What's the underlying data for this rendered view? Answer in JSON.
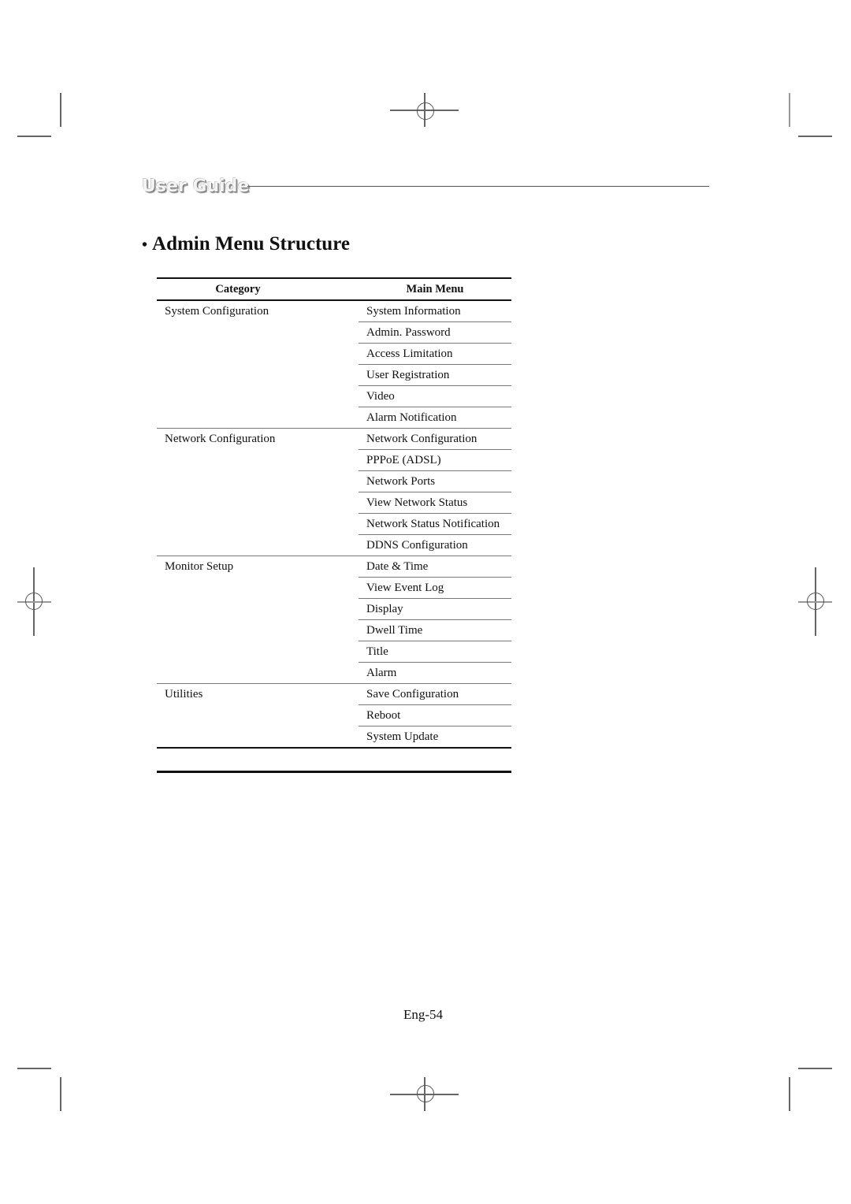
{
  "header": {
    "logo_text": "User Guide"
  },
  "section": {
    "bullet": "•",
    "title": "Admin Menu Structure"
  },
  "table": {
    "headers": {
      "category": "Category",
      "main_menu": "Main Menu"
    },
    "groups": [
      {
        "category": "System Configuration",
        "items": [
          "System Information",
          "Admin. Password",
          "Access Limitation",
          "User Registration",
          "Video",
          "Alarm Notification"
        ]
      },
      {
        "category": "Network Configuration",
        "items": [
          "Network Configuration",
          "PPPoE (ADSL)",
          "Network Ports",
          "View Network Status",
          "Network Status Notification",
          "DDNS Configuration"
        ]
      },
      {
        "category": "Monitor Setup",
        "items": [
          "Date & Time",
          "View Event Log",
          "Display",
          "Dwell Time",
          "Title",
          "Alarm"
        ]
      },
      {
        "category": "Utilities",
        "items": [
          "Save Configuration",
          "Reboot",
          "System Update"
        ]
      }
    ]
  },
  "footer": {
    "page_number": "Eng-54"
  }
}
